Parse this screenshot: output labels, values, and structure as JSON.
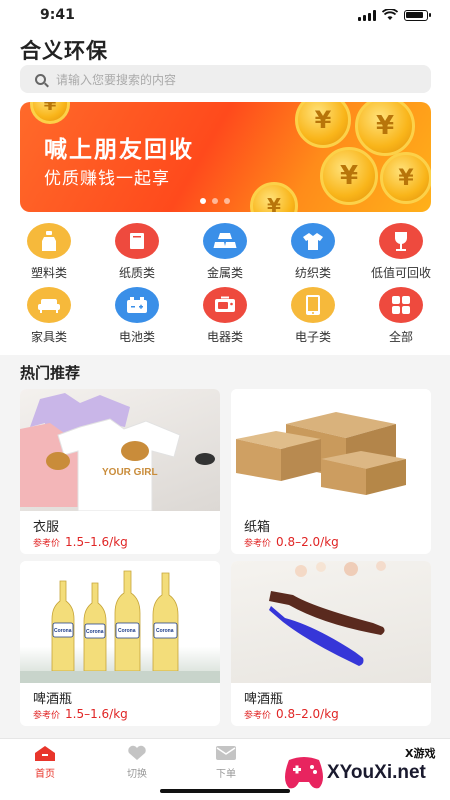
{
  "status": {
    "time": "9:41"
  },
  "header": {
    "app_title": "合义环保"
  },
  "search": {
    "placeholder": "请输入您要搜索的内容"
  },
  "banner": {
    "title": "喊上朋友回收",
    "subtitle": "优质赚钱一起享",
    "coin_symbol": "¥"
  },
  "categories": [
    {
      "label": "塑料类",
      "icon": "plastic-bottle-icon",
      "color": "#f6b93b"
    },
    {
      "label": "纸质类",
      "icon": "paper-book-icon",
      "color": "#ee4a3e"
    },
    {
      "label": "金属类",
      "icon": "metal-bars-icon",
      "color": "#3a8fe8"
    },
    {
      "label": "纺织类",
      "icon": "tshirt-icon",
      "color": "#3a8fe8"
    },
    {
      "label": "低值可回收",
      "icon": "glass-icon",
      "color": "#ee4a3e"
    },
    {
      "label": "家具类",
      "icon": "sofa-icon",
      "color": "#f6b93b"
    },
    {
      "label": "电池类",
      "icon": "battery-icon",
      "color": "#3a8fe8"
    },
    {
      "label": "电器类",
      "icon": "appliance-icon",
      "color": "#ee4a3e"
    },
    {
      "label": "电子类",
      "icon": "tablet-icon",
      "color": "#f6b93b"
    },
    {
      "label": "全部",
      "icon": "grid-icon",
      "color": "#ee4a3e"
    }
  ],
  "hot": {
    "title": "热门推荐",
    "ref_label": "参考价",
    "items": [
      {
        "name": "衣服",
        "price": "1.5–1.6/kg",
        "print_text": "YOUR GIRL"
      },
      {
        "name": "纸箱",
        "price": "0.8–2.0/kg"
      },
      {
        "name": "啤酒瓶",
        "price": "1.5–1.6/kg",
        "label_text": "Corona"
      },
      {
        "name": "啤酒瓶",
        "price": "0.8–2.0/kg"
      }
    ]
  },
  "tabbar": {
    "tabs": [
      {
        "label": "首页",
        "active": true
      },
      {
        "label": "切换"
      },
      {
        "label": "下单"
      }
    ]
  },
  "watermark": {
    "main": "XYouXi.net",
    "small": "X游戏"
  },
  "colors": {
    "accent": "#e8352b",
    "price": "#e02525"
  }
}
